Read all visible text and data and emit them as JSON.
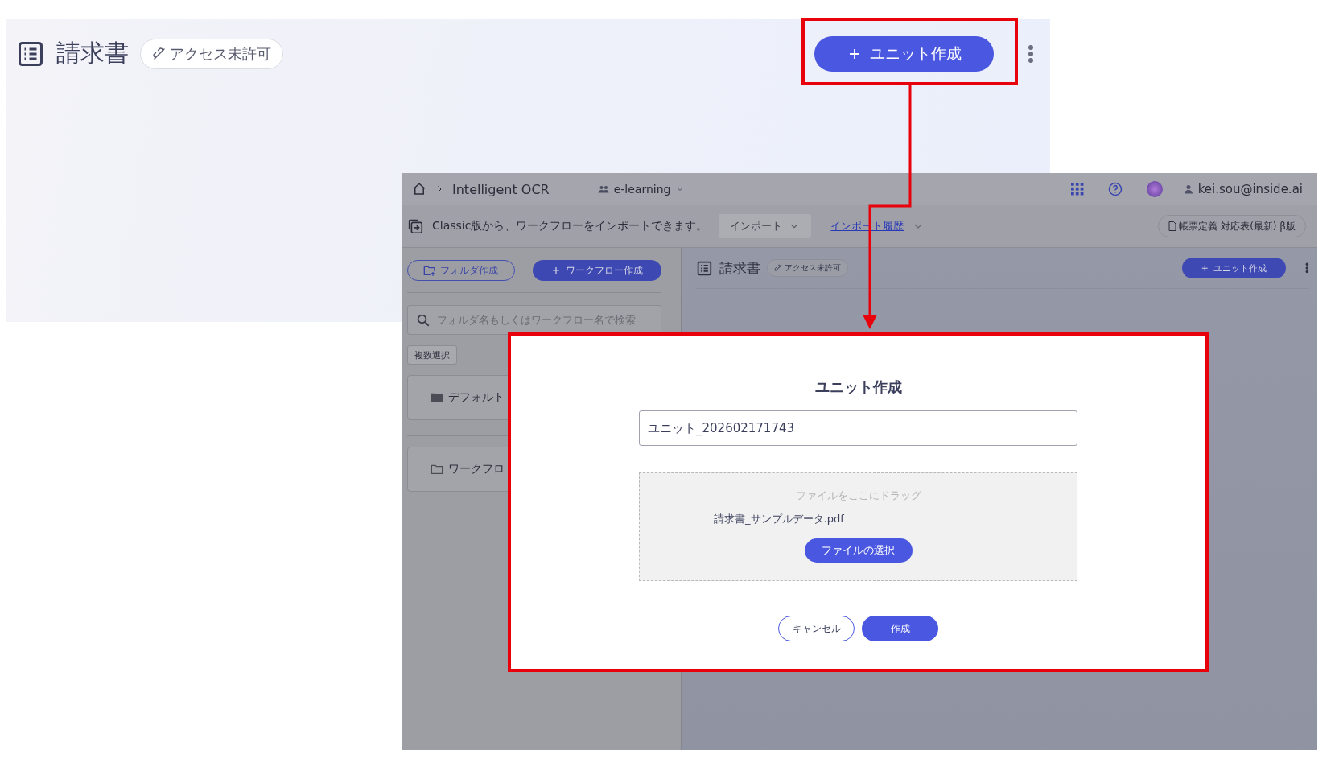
{
  "header_panel": {
    "title": "請求書",
    "access_chip": "アクセス未許可",
    "create_button": "ユニット作成"
  },
  "app": {
    "topbar": {
      "product": "Intelligent OCR",
      "workspace": "e-learning",
      "user": "kei.sou@inside.ai"
    },
    "import_bar": {
      "message": "Classic版から、ワークフローをインポートできます。",
      "import_button": "インポート",
      "history_link": "インポート履歴",
      "definition_button": "帳票定義 対応表(最新) β版"
    },
    "sidebar": {
      "folder_button": "フォルダ作成",
      "workflow_button": "ワークフロー作成",
      "search": {
        "placeholder": "フォルダ名もしくはワークフロー名で検索"
      },
      "multi_select": "複数選択",
      "folders": [
        {
          "name": "デフォルト",
          "kind": "filled"
        },
        {
          "name": "ワークフロ",
          "kind": "outline"
        }
      ]
    },
    "main": {
      "title": "請求書",
      "access_chip": "アクセス未許可",
      "create_button": "ユニット作成"
    }
  },
  "dialog": {
    "title": "ユニット作成",
    "name_field": {
      "value": "ユニット_202602171743"
    },
    "dropzone": {
      "hint": "ファイルをここにドラッグ",
      "file_name": "請求書_サンプルデータ.pdf",
      "select_button": "ファイルの選択"
    },
    "buttons": [
      {
        "label": "キャンセル",
        "kind": "secondary"
      },
      {
        "label": "作成",
        "kind": "primary"
      }
    ]
  }
}
